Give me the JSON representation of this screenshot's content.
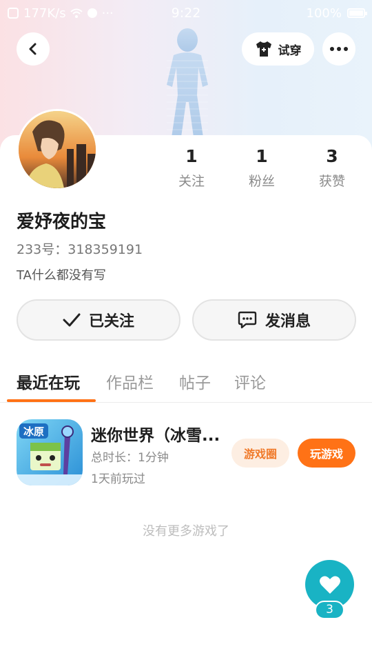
{
  "status_bar": {
    "speed": "177K/s",
    "time": "9:22",
    "battery": "100%"
  },
  "header": {
    "try_on_label": "试穿",
    "icons": [
      "back-icon",
      "tshirt-icon",
      "more-icon"
    ]
  },
  "profile": {
    "name": "爱妤夜的宝",
    "uid_label": "233号：",
    "uid_value": "318359191",
    "bio": "TA什么都没有写",
    "stats": [
      {
        "value": "1",
        "label": "关注"
      },
      {
        "value": "1",
        "label": "粉丝"
      },
      {
        "value": "3",
        "label": "获赞"
      }
    ]
  },
  "actions": {
    "followed_label": "已关注",
    "message_label": "发消息"
  },
  "tabs": [
    {
      "label": "最近在玩",
      "active": true
    },
    {
      "label": "作品栏",
      "active": false
    },
    {
      "label": "帖子",
      "active": false
    },
    {
      "label": "评论",
      "active": false
    }
  ],
  "games": [
    {
      "title": "迷你世界（冰雪...",
      "duration": "总时长：1分钟",
      "last_played": "1天前玩过",
      "icon_text": "冰原",
      "circle_label": "游戏圈",
      "play_label": "玩游戏"
    }
  ],
  "no_more_text": "没有更多游戏了",
  "like": {
    "count": "3"
  },
  "colors": {
    "accent": "#ff7216",
    "like_fab": "#19b3c4",
    "pill_light": "#fdeee2"
  }
}
